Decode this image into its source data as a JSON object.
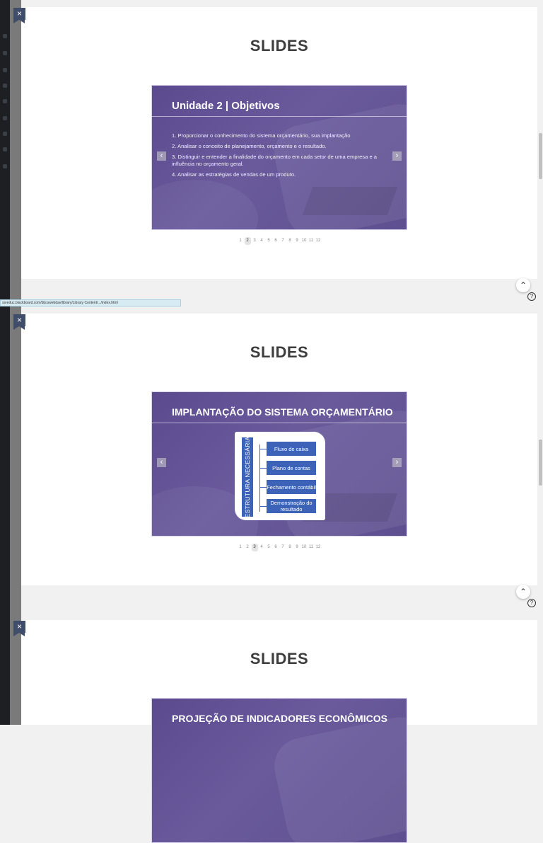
{
  "url_status": "ssreduc.blackboard.com/bbcswebdav/library/Library Content/.../index.html",
  "close_label": "×",
  "nav_prev": "‹",
  "nav_next": "›",
  "scroll_top_glyph": "⌃",
  "help_glyph": "?",
  "colors": {
    "slide_bg": "#5c4a8e",
    "diagram_blue": "#3d63b8",
    "close_badge": "#3f4d6b"
  },
  "sections": [
    {
      "title": "SLIDES",
      "slide": {
        "heading": "Unidade 2 | Objetivos",
        "items": [
          "1. Proporcionar o conhecimento do sistema orçamentário, sua implantação",
          "2. Analisar o conceito de planejamento, orçamento e o resultado.",
          "3. Distinguir e entender a finalidade do orçamento em cada setor de uma empresa e a influência no orçamento geral.",
          "4. Analisar as  estratégias de vendas de um produto."
        ]
      },
      "pager": {
        "pages": [
          "1",
          "2",
          "3",
          "4",
          "5",
          "6",
          "7",
          "8",
          "9",
          "10",
          "11",
          "12"
        ],
        "active": "2"
      }
    },
    {
      "title": "SLIDES",
      "slide": {
        "heading": "IMPLANTAÇÃO DO SISTEMA ORÇAMENTÁRIO",
        "diagram": {
          "vertical_label": "ESTRUTURA NECESSÁRIA",
          "boxes": [
            "Fluxo de caixa",
            "Plano de contas",
            "Fechamento contábil",
            "Demonstração do resultado"
          ]
        }
      },
      "pager": {
        "pages": [
          "1",
          "2",
          "3",
          "4",
          "5",
          "6",
          "7",
          "8",
          "9",
          "10",
          "11",
          "12"
        ],
        "active": "3"
      }
    },
    {
      "title": "SLIDES",
      "slide": {
        "heading": "PROJEÇÃO DE INDICADORES ECONÔMICOS"
      }
    }
  ]
}
